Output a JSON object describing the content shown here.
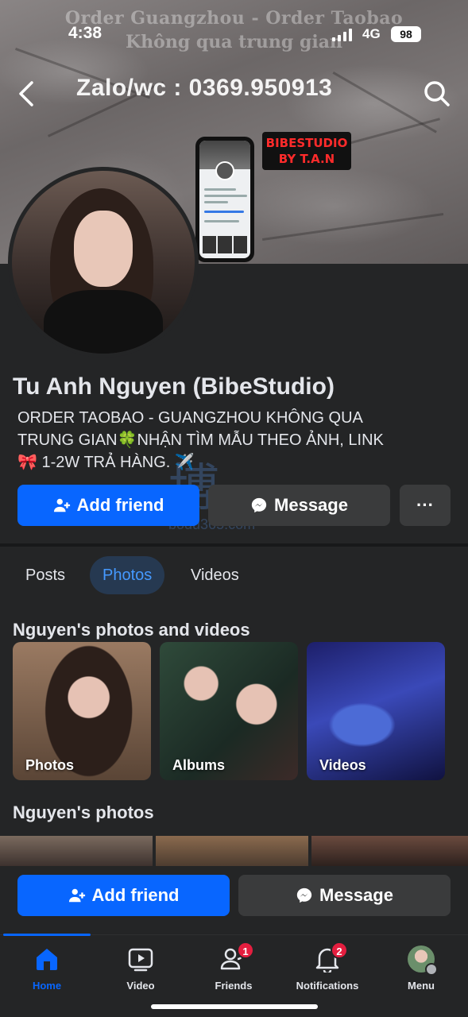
{
  "status_bar": {
    "time": "4:38",
    "network": "4G",
    "battery": "98"
  },
  "cover": {
    "line1": "Order Guangzhou - Order Taobao",
    "line2": "Không qua trung gian",
    "contact": "Zalo/wc : 0369.950913",
    "badge_line1": "BIBESTUDIO",
    "badge_line2": "BY T.A.N"
  },
  "profile": {
    "name": "Tu Anh Nguyen (BibeStudio)",
    "bio_line1": "ORDER TAOBAO - GUANGZHOU KHÔNG QUA",
    "bio_line2": "TRUNG GIAN🍀NHẬN TÌM MẪU THEO ẢNH, LINK",
    "bio_line3": "🎀 1-2W TRẢ HÀNG. ✈️"
  },
  "actions": {
    "add_friend": "Add friend",
    "message": "Message",
    "more": "···"
  },
  "tabs": [
    {
      "label": "Posts"
    },
    {
      "label": "Photos"
    },
    {
      "label": "Videos"
    }
  ],
  "photos_section": {
    "title": "Nguyen's photos and videos",
    "tiles": [
      {
        "label": "Photos"
      },
      {
        "label": "Albums"
      },
      {
        "label": "Videos"
      }
    ]
  },
  "photos_section2": {
    "title": "Nguyen's photos"
  },
  "bottom_actions": {
    "add_friend": "Add friend",
    "message": "Message"
  },
  "tabbar": {
    "items": [
      {
        "label": "Home",
        "icon": "home-icon"
      },
      {
        "label": "Video",
        "icon": "video-icon"
      },
      {
        "label": "Friends",
        "icon": "friends-icon",
        "badge": "1"
      },
      {
        "label": "Notifications",
        "icon": "bell-icon",
        "badge": "2"
      },
      {
        "label": "Menu",
        "icon": "menu-avatar-icon"
      }
    ]
  },
  "watermark": {
    "glyph": "博",
    "text": "bodu365.com"
  },
  "colors": {
    "background": "#242526",
    "primary": "#0866ff",
    "secondary_button": "#3a3b3c",
    "badge": "#e41e3f"
  }
}
